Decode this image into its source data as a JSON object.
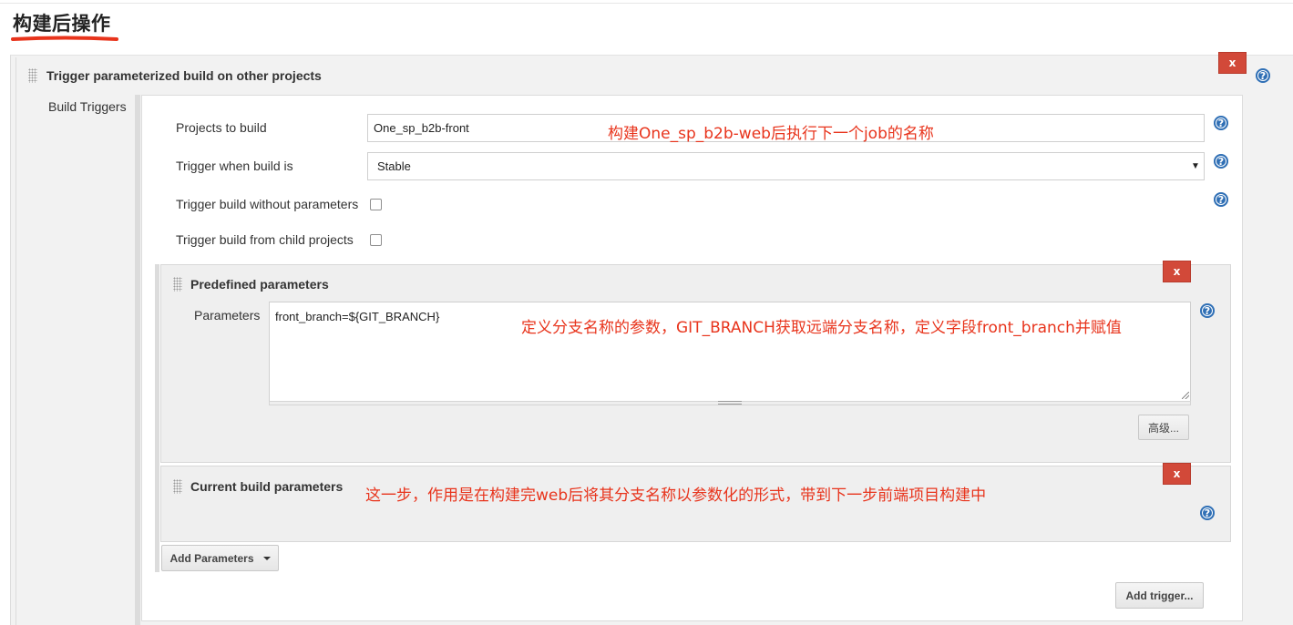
{
  "section": {
    "title": "构建后操作"
  },
  "trigger_panel": {
    "title": "Trigger parameterized build on other projects",
    "close_label": "x",
    "left_label": "Build Triggers"
  },
  "fields": {
    "projects_label": "Projects to build",
    "projects_value": "One_sp_b2b-front",
    "trigger_when_label": "Trigger when build is",
    "trigger_when_value": "Stable",
    "without_params_label": "Trigger build without parameters",
    "from_child_label": "Trigger build from child projects"
  },
  "predefined": {
    "title": "Predefined parameters",
    "close_label": "x",
    "params_label": "Parameters",
    "params_value": "front_branch=${GIT_BRANCH}",
    "advanced_button": "高级..."
  },
  "current": {
    "title": "Current build parameters",
    "close_label": "x"
  },
  "buttons": {
    "add_parameters": "Add Parameters",
    "add_trigger": "Add trigger..."
  },
  "help_icon_glyph": "?",
  "annotations": {
    "projects_note": "构建One_sp_b2b-web后执行下一个job的名称",
    "params_note": "定义分支名称的参数，GIT_BRANCH获取远端分支名称，定义字段front_branch并赋值",
    "current_note": "这一步，作用是在构建完web后将其分支名称以参数化的形式，带到下一步前端项目构建中"
  },
  "colors": {
    "annotation": "#e8341c",
    "close_button": "#d24939",
    "help_icon": "#2f6fb5"
  }
}
